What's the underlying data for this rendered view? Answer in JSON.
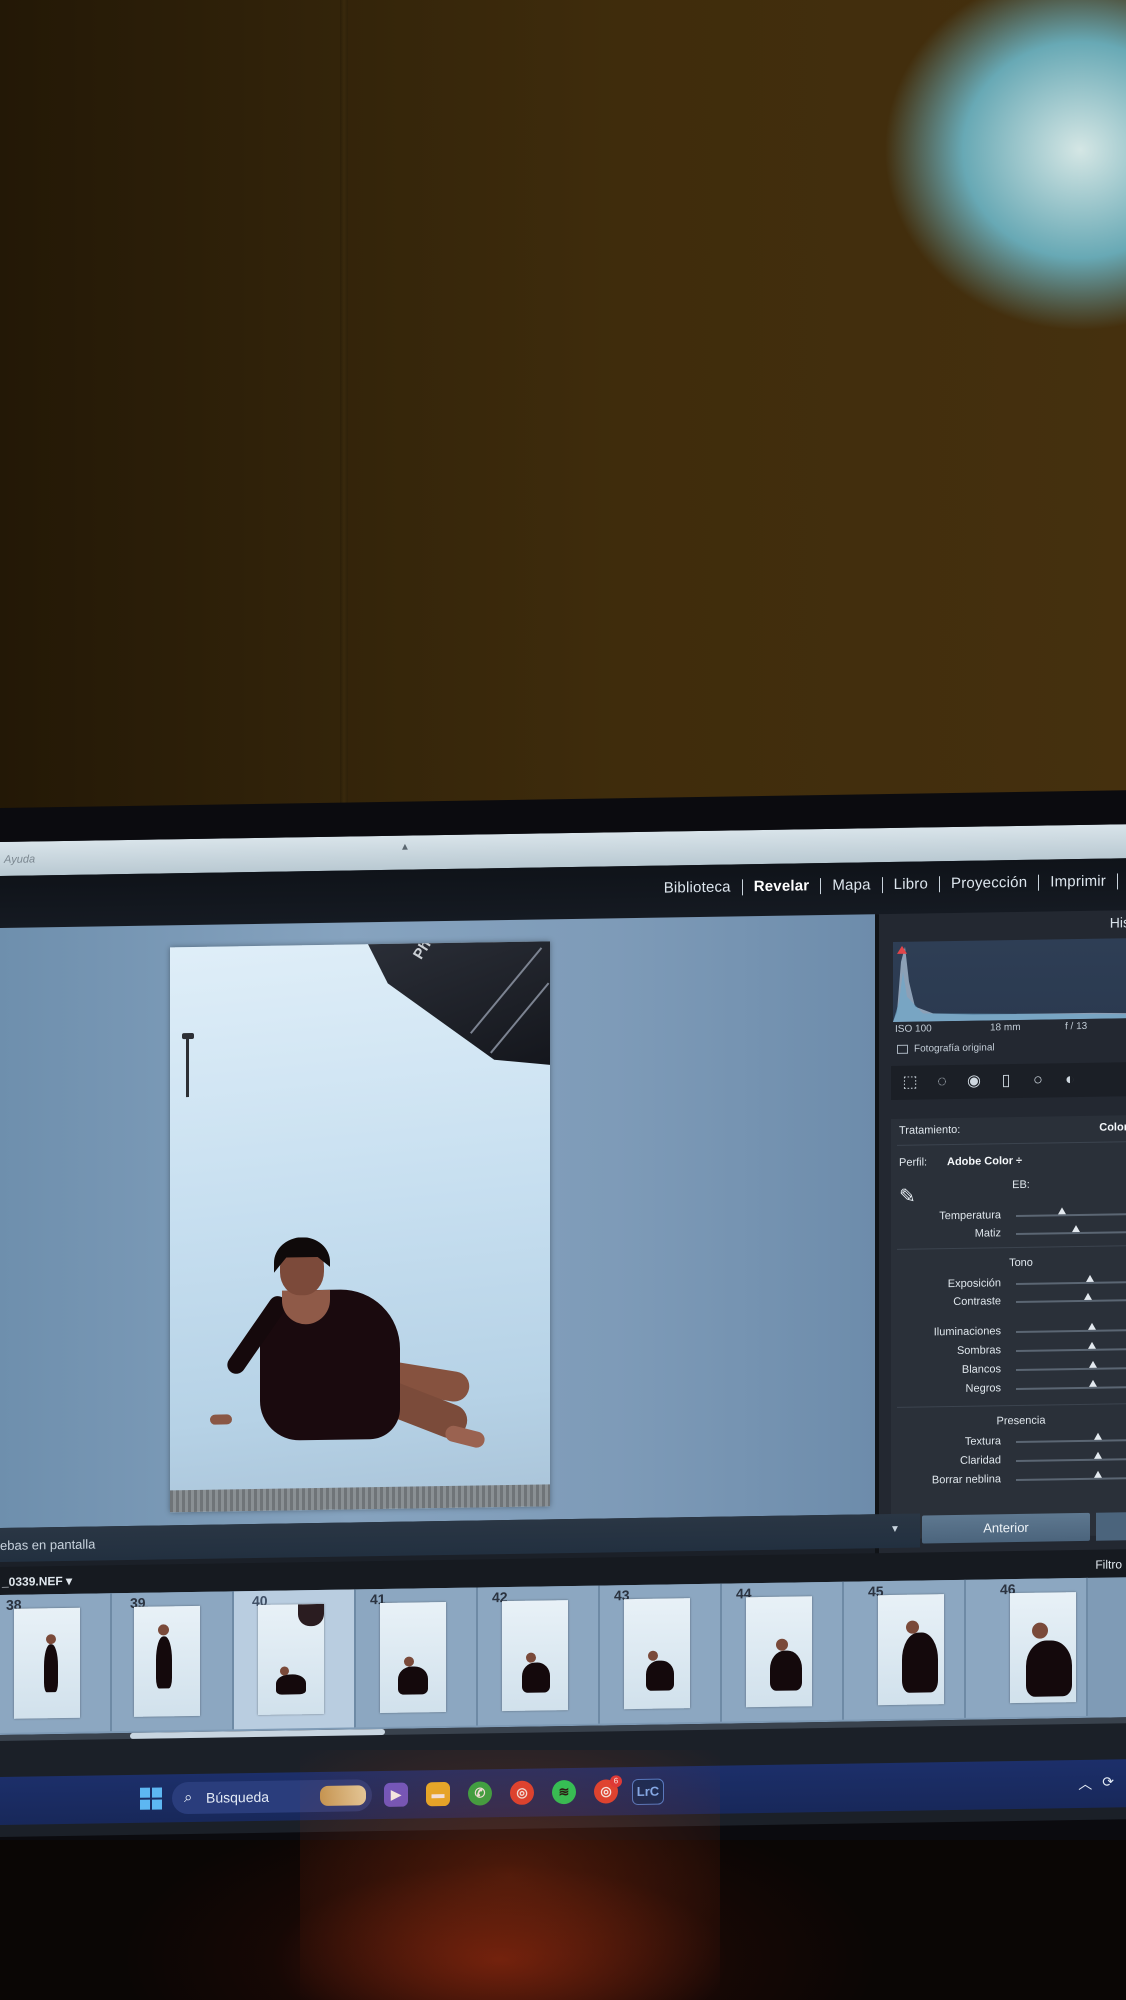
{
  "menu_strip": {
    "help": "Ayuda"
  },
  "modules": {
    "items": [
      "Biblioteca",
      "Revelar",
      "Mapa",
      "Libro",
      "Proyección",
      "Imprimir"
    ],
    "active": "Revelar"
  },
  "viewer": {
    "softbox_text": "Photo"
  },
  "right_panel": {
    "header": "His",
    "exif": {
      "iso": "ISO 100",
      "focal": "18 mm",
      "aperture": "f / 13"
    },
    "original_photo": "Fotografía original",
    "treatment_label": "Tratamiento:",
    "treatment_value": "Color",
    "profile_label": "Perfil:",
    "profile_value": "Adobe Color ÷",
    "wb_label": "EB:",
    "wb_sliders": [
      {
        "label": "Temperatura",
        "value": 0.38
      },
      {
        "label": "Matiz",
        "value": 0.5
      }
    ],
    "tone_label": "Tono",
    "tone_sliders": [
      {
        "label": "Exposición",
        "value": 0.62
      },
      {
        "label": "Contraste",
        "value": 0.6
      }
    ],
    "tone_sliders_2": [
      {
        "label": "Iluminaciones",
        "value": 0.63
      },
      {
        "label": "Sombras",
        "value": 0.63
      },
      {
        "label": "Blancos",
        "value": 0.64
      },
      {
        "label": "Negros",
        "value": 0.64
      }
    ],
    "presence_label": "Presencia",
    "presence_sliders": [
      {
        "label": "Textura",
        "value": 0.68
      },
      {
        "label": "Claridad",
        "value": 0.68
      },
      {
        "label": "Borrar neblina",
        "value": 0.68
      }
    ]
  },
  "toolbar": {
    "preview_label": "ebas en pantalla"
  },
  "prev_button": "Anterior",
  "filmstrip": {
    "filename": "_0339.NEF",
    "filter": "Filtro",
    "numbers": [
      "38",
      "39",
      "40",
      "41",
      "42",
      "43",
      "44",
      "45",
      "46"
    ],
    "selected": "40"
  },
  "taskbar": {
    "search_label": "Búsqueda",
    "lrc_label": "LrC",
    "chrome_badge": "6"
  }
}
